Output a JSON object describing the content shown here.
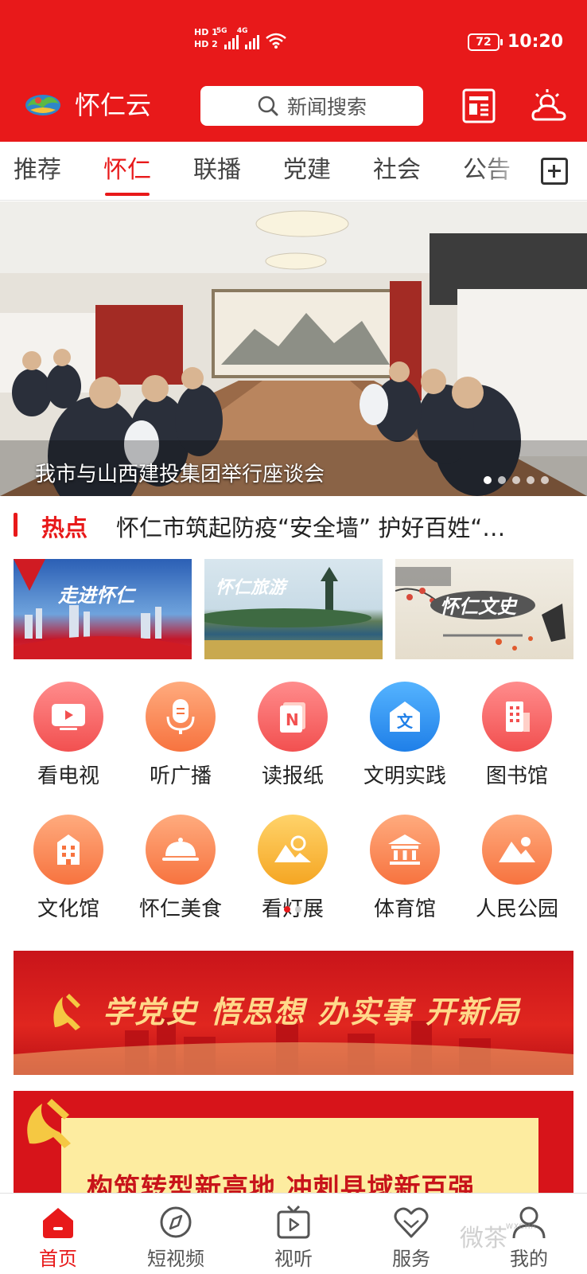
{
  "status_bar": {
    "hd1": "HD 1",
    "hd2": "HD 2",
    "net1": "5G",
    "net2": "4G",
    "battery": "72",
    "time": "10:20"
  },
  "header": {
    "app_name": "怀仁云",
    "search_placeholder": "新闻搜索",
    "icons": [
      "logo",
      "search-icon",
      "newspaper-icon",
      "weather-icon"
    ]
  },
  "tabs": [
    "推荐",
    "怀仁",
    "联播",
    "党建",
    "社会",
    "公告"
  ],
  "active_tab": "怀仁",
  "hero": {
    "caption": "我市与山西建投集团举行座谈会",
    "slide_count": 5,
    "active_slide": 1
  },
  "hot": {
    "label": "热点",
    "headline": "怀仁市筑起防疫“安全墙” 护好百姓“…"
  },
  "banners": [
    {
      "title": "走进怀仁"
    },
    {
      "title": "怀仁旅游"
    },
    {
      "title": "怀仁文史"
    }
  ],
  "services": [
    {
      "label": "看电视",
      "icon": "tv-icon"
    },
    {
      "label": "听广播",
      "icon": "microphone-icon"
    },
    {
      "label": "读报纸",
      "icon": "newspaper-icon"
    },
    {
      "label": "文明实践",
      "icon": "civility-icon"
    },
    {
      "label": "图书馆",
      "icon": "building-icon"
    },
    {
      "label": "文化馆",
      "icon": "culture-hall-icon"
    },
    {
      "label": "怀仁美食",
      "icon": "food-cloche-icon"
    },
    {
      "label": "看灯展",
      "icon": "landscape-icon"
    },
    {
      "label": "体育馆",
      "icon": "stadium-icon"
    },
    {
      "label": "人民公园",
      "icon": "mountain-icon"
    }
  ],
  "page_indicator": {
    "count": 2,
    "active": 1
  },
  "promos": [
    {
      "slogan": "学党史 悟思想 办实事 开新局"
    },
    {
      "slogan": "构筑转型新高地 冲刺县域新百强"
    }
  ],
  "bottom_nav": [
    {
      "label": "首页",
      "icon": "home-icon"
    },
    {
      "label": "短视频",
      "icon": "compass-icon"
    },
    {
      "label": "视听",
      "icon": "tv-play-icon"
    },
    {
      "label": "服务",
      "icon": "heart-icon"
    },
    {
      "label": "我的",
      "icon": "user-icon"
    }
  ],
  "active_nav": "首页",
  "watermark": "微茶",
  "watermark_sub": "WXCHA",
  "colors": {
    "brand_red": "#e8191a",
    "text_dark": "#222222",
    "text_gray": "#555555"
  }
}
